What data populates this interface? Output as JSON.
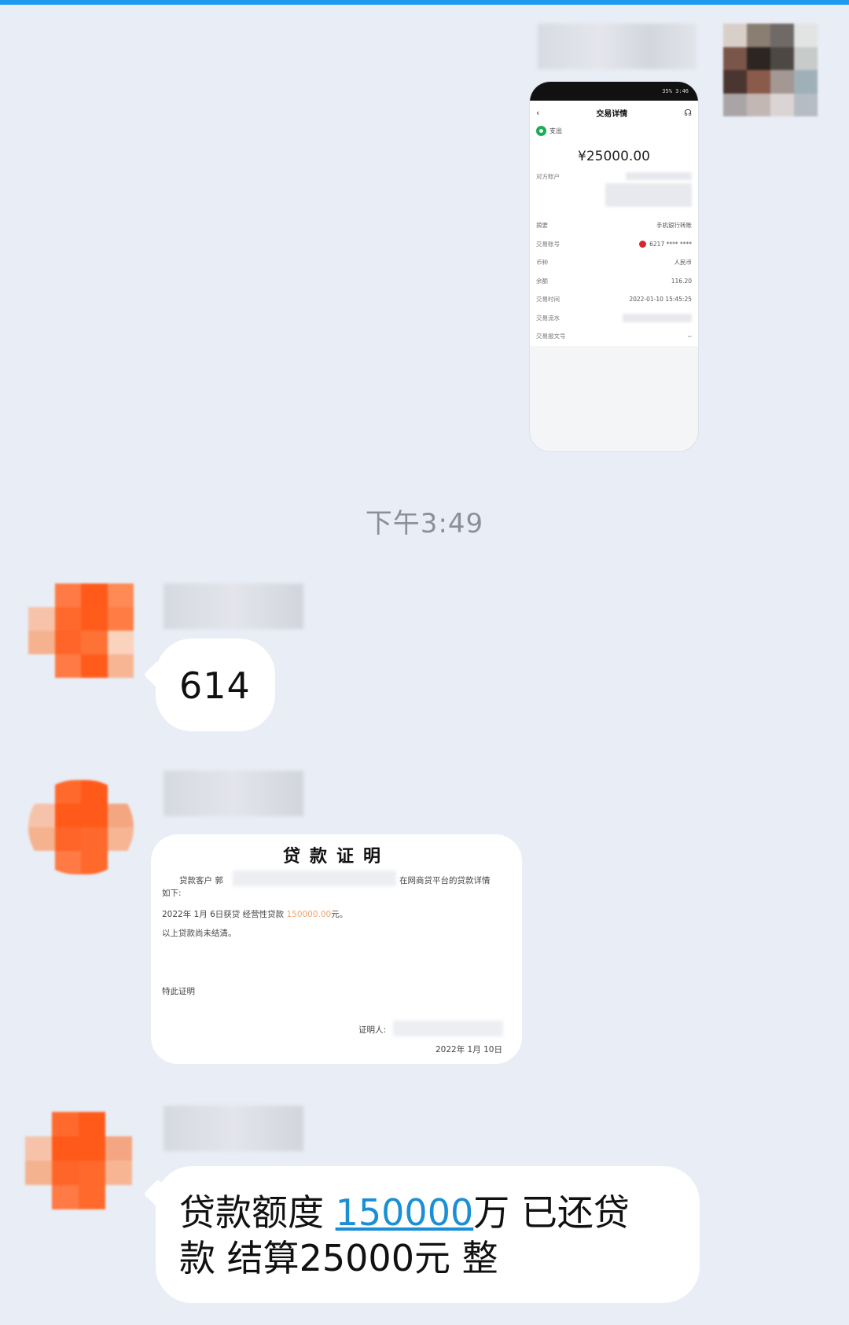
{
  "timestamp": "下午3:49",
  "outgoing": {
    "screenshot": {
      "status_text": "35% 3:46",
      "nav_title": "交易详情",
      "tx_type": "支出",
      "amount": "¥25000.00",
      "rows": [
        {
          "key": "对方账户",
          "value": ""
        },
        {
          "key": "摘要",
          "value": "手机银行转账"
        },
        {
          "key": "交易账号",
          "value": "6217 **** ****"
        },
        {
          "key": "币种",
          "value": "人民币"
        },
        {
          "key": "余额",
          "value": "116.20"
        },
        {
          "key": "交易时间",
          "value": "2022-01-10 15:45:25"
        },
        {
          "key": "交易流水",
          "value": ""
        },
        {
          "key": "交易报文号",
          "value": "--"
        }
      ]
    }
  },
  "messages": [
    {
      "text": "614"
    },
    {
      "certificate": {
        "title": "贷款证明",
        "line1_prefix": "贷款客户 郭",
        "line1_suffix": "在网商贷平台的贷款详情",
        "line2": "如下:",
        "line3_prefix": "2022年 1月 6日获贷 经营性贷款",
        "line3_amount": "150000.00",
        "line3_suffix": "元。",
        "line4": "以上贷款尚未结清。",
        "line5": "特此证明",
        "witness_label": "证明人:",
        "date": "2022年 1月 10日"
      }
    },
    {
      "text_part1": "贷款额度 ",
      "text_link": "150000",
      "text_part2": "万 已还贷",
      "text_line2": "款 结算25000元 整"
    }
  ],
  "colors": {
    "background": "#e9edf5",
    "bubble": "#ffffff",
    "link": "#1a8fd6",
    "avatar_orange": "#ff5a1f",
    "accent_bar": "#1e9bf0"
  }
}
